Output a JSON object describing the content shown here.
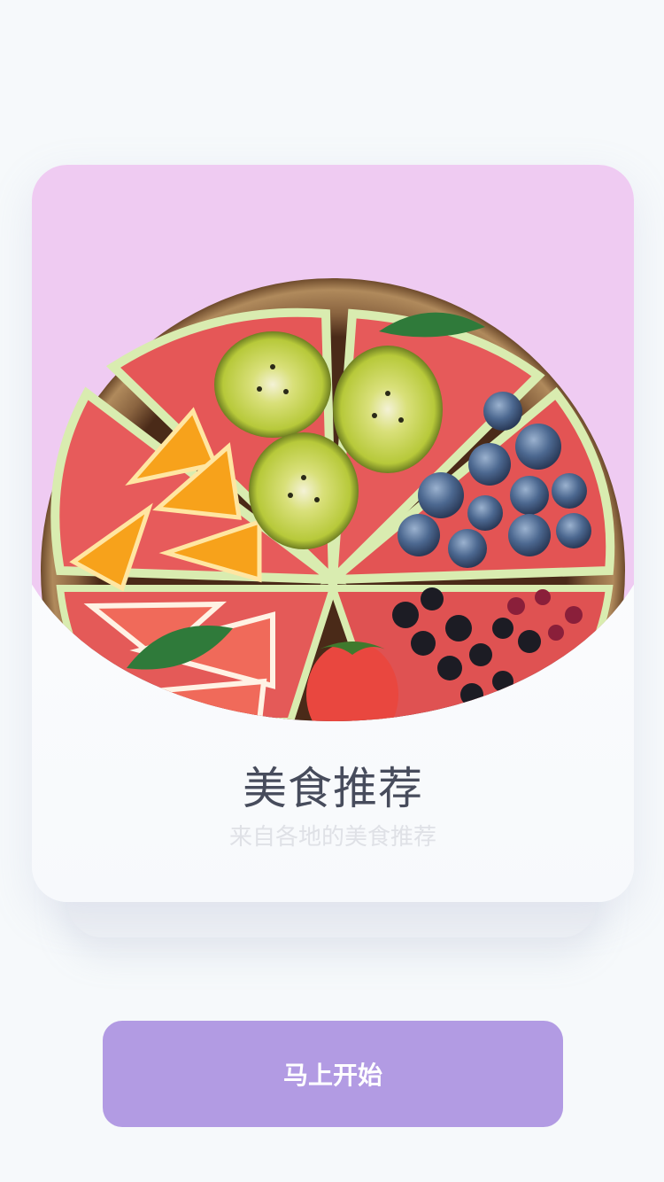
{
  "card": {
    "title": "美食推荐",
    "subtitle": "来自各地的美食推荐",
    "image_subject": "fruit-pizza-platter"
  },
  "actions": {
    "start_label": "马上开始"
  },
  "colors": {
    "page_background": "#f6f9fb",
    "card_top": "#efcbf2",
    "button": "#b29be3",
    "title": "#474c5c",
    "subtitle": "#dfe1e6"
  }
}
